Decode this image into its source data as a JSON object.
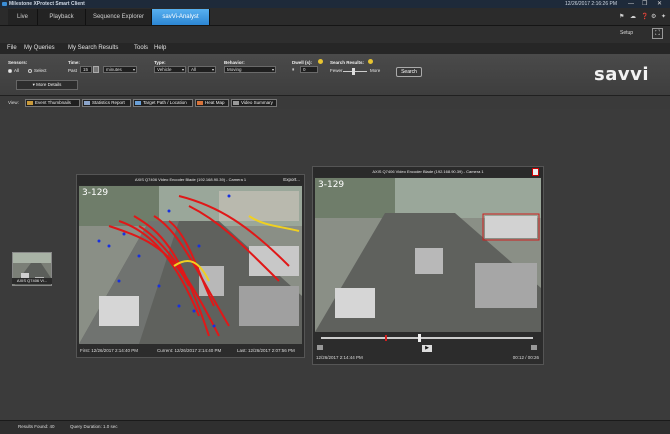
{
  "titlebar": {
    "app_title": "Milestone XProtect Smart Client",
    "datetime": "12/26/2017 2:16:26 PM",
    "minimize": "—",
    "maximize": "❐",
    "close": "✕"
  },
  "tabs": [
    {
      "label": "Live",
      "active": false
    },
    {
      "label": "Playback",
      "active": false
    },
    {
      "label": "Sequence Explorer",
      "active": false
    },
    {
      "label": "savVi-Analyst",
      "active": true
    }
  ],
  "setupbar": {
    "setup_label": "Setup"
  },
  "menu": [
    "File",
    "My Queries",
    "My Search Results",
    "Tools",
    "Help"
  ],
  "search": {
    "sensors_label": "Sensors:",
    "sensors_all": "All",
    "sensors_select": "Select",
    "time_label": "Time:",
    "time_past": "Past",
    "time_count": "15",
    "time_unit": "minutes",
    "type_label": "Type:",
    "type_value": "Vehicle",
    "type_sub": "All",
    "behavior_label": "Behavior:",
    "behavior_value": "Moving",
    "dwell_label": "Dwell (s):",
    "dwell_value": "0",
    "results_label": "Search Results:",
    "fewer": "Fewer",
    "more": "More",
    "search_button": "Search",
    "more_details": "More Details"
  },
  "brand": "savvi",
  "view": {
    "label": "View:",
    "buttons": [
      "Event Thumbnails",
      "Statistics Report",
      "Target Path / Location",
      "Heat Map",
      "Video Summary"
    ]
  },
  "camera_left": {
    "title": "AXIS Q7406 Video Encoder Blade (192.168.90.39) - Camera 1",
    "export": "Export...",
    "overlay": "3-129",
    "first": "First: 12/26/2017 2:14:40 PM",
    "current": "Current: 12/26/2017 2:14:40 PM",
    "last": "Last: 12/26/2017 2:07:56 PM"
  },
  "camera_right": {
    "title": "AXIS Q7406 Video Encoder Blade (192.168.90.39) - Camera 1",
    "overlay": "3-129",
    "timestamp": "12/26/2017 2:14:44 PM",
    "duration": "00:12 / 00:26",
    "playback_progress": 0.46
  },
  "side_thumb": {
    "label": "AXIS Q7406 Vi..."
  },
  "status": {
    "results_found": "Results Found: 40",
    "query_duration": "Query Duration: 1.0 sec"
  },
  "colors": {
    "accent_tab": "#2c86d3",
    "track_red": "#e01818",
    "track_yellow": "#f0d020",
    "track_blue": "#1830e0",
    "help_dot": "#e8c431"
  }
}
